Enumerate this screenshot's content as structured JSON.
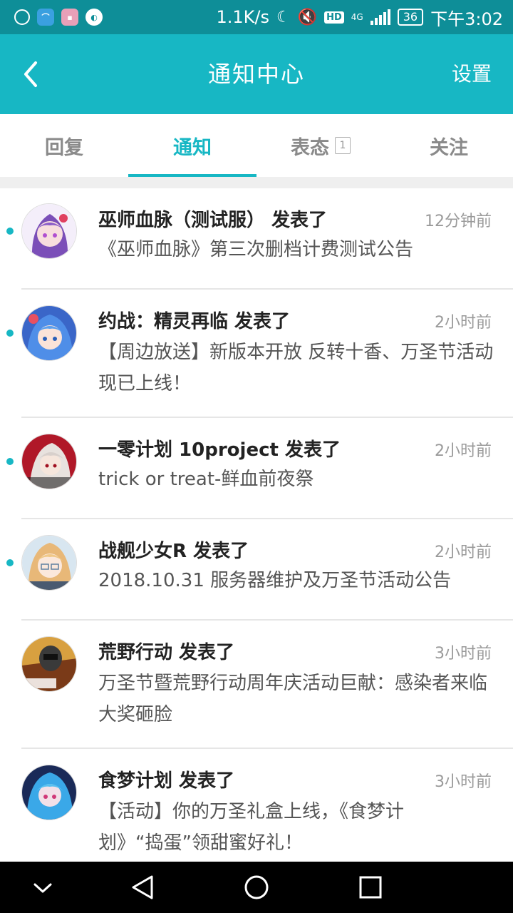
{
  "status_bar": {
    "net_speed": "1.1K/s",
    "network": "4G",
    "hd": "HD",
    "battery": "36",
    "time": "下午3:02",
    "app_icons": [
      "clock-icon",
      "app-blue-icon",
      "app-pink-icon",
      "app-q-icon"
    ]
  },
  "header": {
    "title": "通知中心",
    "action": "设置"
  },
  "tabs": [
    {
      "label": "回复"
    },
    {
      "label": "通知"
    },
    {
      "label": "表态",
      "badge": "1"
    },
    {
      "label": "关注"
    }
  ],
  "active_tab": "通知",
  "notifications": [
    {
      "title": "巫师血脉（测试服） 发表了",
      "time": "12分钟前",
      "body": "《巫师血脉》第三次删档计费测试公告",
      "unread": true
    },
    {
      "title": "约战：精灵再临 发表了",
      "time": "2小时前",
      "body": "【周边放送】新版本开放 反转十香、万圣节活动现已上线！",
      "unread": true
    },
    {
      "title": "一零计划 10project 发表了",
      "time": "2小时前",
      "body": "trick or treat-鲜血前夜祭",
      "unread": true
    },
    {
      "title": "战舰少女R 发表了",
      "time": "2小时前",
      "body": "2018.10.31 服务器维护及万圣节活动公告",
      "unread": true
    },
    {
      "title": "荒野行动 发表了",
      "time": "3小时前",
      "body": "万圣节暨荒野行动周年庆活动巨献：感染者来临 大奖砸脸",
      "unread": false
    },
    {
      "title": "食梦计划 发表了",
      "time": "3小时前",
      "body": "【活动】你的万圣礼盒上线，《食梦计划》“捣蛋”领甜蜜好礼！",
      "unread": false
    }
  ],
  "colors": {
    "accent": "#17b7c4",
    "status_bar": "#0e8e98",
    "unread_dot": "#17b7c4"
  }
}
